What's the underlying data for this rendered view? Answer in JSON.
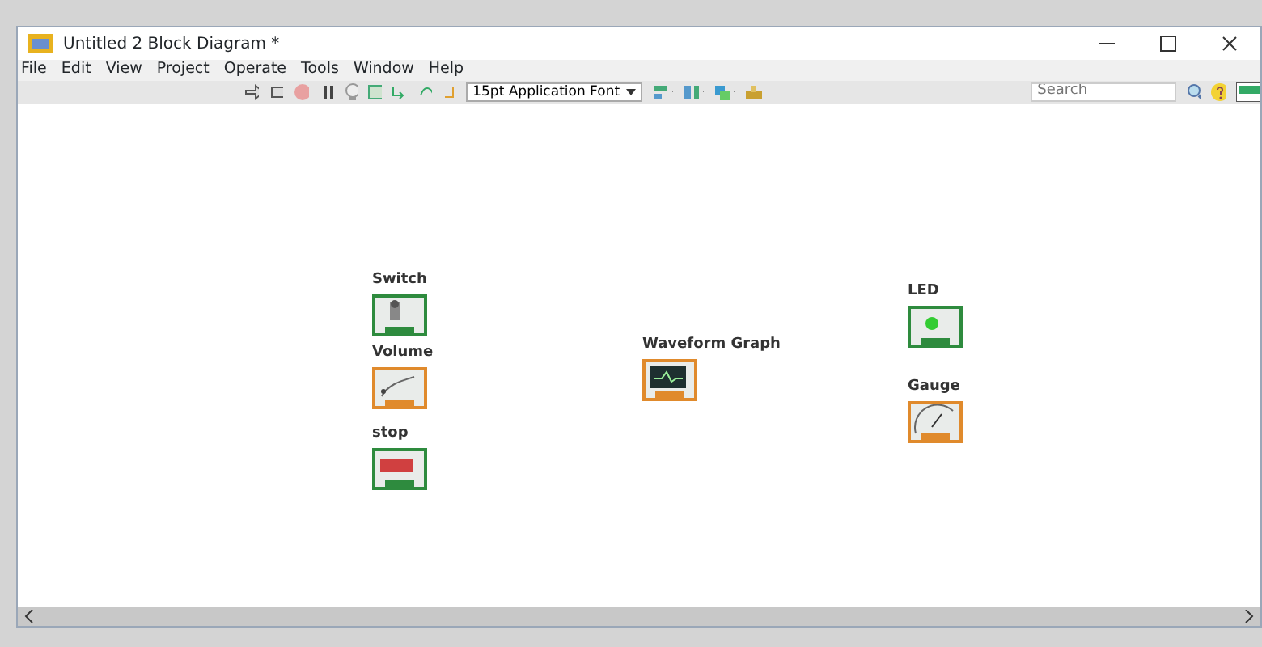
{
  "window": {
    "title": "Untitled 2 Block Diagram *"
  },
  "menu": [
    "File",
    "Edit",
    "View",
    "Project",
    "Operate",
    "Tools",
    "Window",
    "Help"
  ],
  "toolbar": {
    "font": "15pt Application Font",
    "search": {
      "placeholder": "Search"
    }
  },
  "terminals": [
    {
      "label": "Switch",
      "kind": "switch",
      "color": "#2e8b3e"
    },
    {
      "label": "Volume",
      "kind": "knob",
      "color": "#e08a2c"
    },
    {
      "label": "stop",
      "kind": "stop",
      "color": "#2e8b3e"
    },
    {
      "label": "Waveform Graph",
      "kind": "graph",
      "color": "#e08a2c"
    },
    {
      "label": "LED",
      "kind": "led",
      "color": "#2e8b3e"
    },
    {
      "label": "Gauge",
      "kind": "gauge",
      "color": "#e08a2c"
    }
  ]
}
